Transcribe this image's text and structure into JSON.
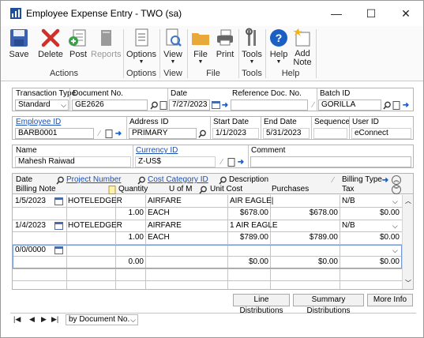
{
  "window": {
    "title": "Employee Expense Entry  -  TWO (sa)",
    "minimize_glyph": "—",
    "maximize_glyph": "☐",
    "close_glyph": "✕"
  },
  "ribbon": {
    "save": "Save",
    "delete": "Delete",
    "post": "Post",
    "reports": "Reports",
    "options": "Options",
    "view": "View",
    "file": "File",
    "print": "Print",
    "tools": "Tools",
    "help": "Help",
    "add_note_1": "Add",
    "add_note_2": "Note",
    "groups": {
      "actions": "Actions",
      "options": "Options",
      "view": "View",
      "file": "File",
      "tools": "Tools",
      "help": "Help"
    }
  },
  "header": {
    "transaction_type_label": "Transaction Type",
    "transaction_type_value": "Standard",
    "document_no_label": "Document No.",
    "document_no_value": "GE2626",
    "date_label": "Date",
    "date_value": "7/27/2023",
    "reference_doc_label": "Reference Doc. No.",
    "reference_doc_value": "",
    "batch_id_label": "Batch ID",
    "batch_id_value": "GORILLA"
  },
  "employee": {
    "employee_id_label": "Employee ID",
    "employee_id_value": "BARB0001",
    "address_id_label": "Address ID",
    "address_id_value": "PRIMARY",
    "start_date_label": "Start Date",
    "start_date_value": "1/1/2023",
    "end_date_label": "End Date",
    "end_date_value": "5/31/2023",
    "sequence_label": "Sequence",
    "sequence_value": "",
    "user_id_label": "User ID",
    "user_id_value": "eConnect",
    "name_label": "Name",
    "name_value": "Mahesh Raiwad",
    "currency_id_label": "Currency ID",
    "currency_id_value": "Z-US$",
    "comment_label": "Comment",
    "comment_value": ""
  },
  "grid": {
    "headers_row1": {
      "date": "Date",
      "project_number": "Project Number",
      "cost_category_id": "Cost Category ID",
      "description": "Description",
      "billing_type": "Billing Type"
    },
    "headers_row2": {
      "billing_note": "Billing Note",
      "quantity": "Quantity",
      "uofm": "U of M",
      "unit_cost": "Unit Cost",
      "purchases": "Purchases",
      "tax": "Tax"
    },
    "rows": [
      {
        "date": "1/5/2023",
        "project": "HOTELEDGER",
        "cost_category": "AIRFARE",
        "description": "AIR EAGLE|",
        "billing_type": "N/B",
        "billing_note": "",
        "quantity": "1.00",
        "uofm": "EACH",
        "unit_cost": "$678.00",
        "purchases": "$678.00",
        "tax": "$0.00"
      },
      {
        "date": "1/4/2023",
        "project": "HOTELEDGER",
        "cost_category": "AIRFARE",
        "description": "1 AIR EAGLE",
        "billing_type": "N/B",
        "billing_note": "",
        "quantity": "1.00",
        "uofm": "EACH",
        "unit_cost": "$789.00",
        "purchases": "$789.00",
        "tax": "$0.00"
      },
      {
        "date": "0/0/0000",
        "project": "",
        "cost_category": "",
        "description": "",
        "billing_type": "",
        "billing_note": "",
        "quantity": "0.00",
        "uofm": "",
        "unit_cost": "$0.00",
        "purchases": "$0.00",
        "tax": "$0.00"
      }
    ]
  },
  "footer_buttons": {
    "line_distributions": "Line Distributions",
    "summary_distributions": "Summary Distributions",
    "more_info": "More Info"
  },
  "navigation": {
    "sort_by": "by Document No."
  },
  "colors": {
    "accent_blue": "#1a5fc4",
    "delete_red": "#d0302a",
    "link_blue": "#1a4fb6"
  }
}
